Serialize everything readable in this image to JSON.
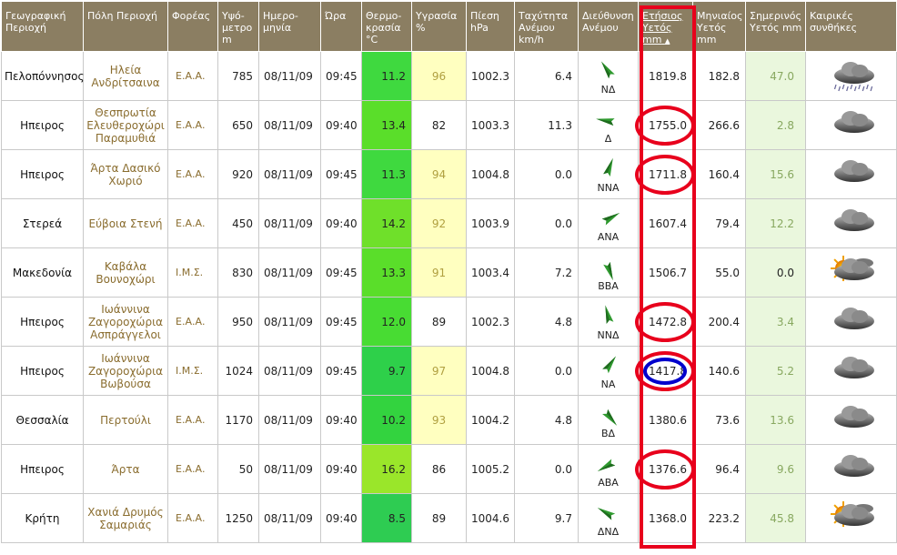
{
  "headers": {
    "region": "Γεωγραφική Περιοχή",
    "city": "Πόλη Περιοχή",
    "operator": "Φορέας",
    "altitude": "Υψό-μετρο m",
    "date": "Ημερο-μηνία",
    "time": "Ώρα",
    "temperature": "Θερμο-κρασία °C",
    "humidity": "Υγρασία %",
    "pressure": "Πίεση hPa",
    "wind_speed": "Ταχύτητα Ανέμου km/h",
    "wind_dir": "Διεύθυνση Ανέμου",
    "annual_rain": "Ετήσιος Υετός mm",
    "monthly_rain": "Μηνιαίος Υετός mm",
    "today_rain": "Σημερινός Υετός mm",
    "conditions": "Καιρικές συνθήκες"
  },
  "sort_indicator": "▲",
  "colors": {
    "header_bg": "#8b7e62",
    "highlight_red": "#e8001c",
    "highlight_blue": "#0000cc",
    "wind_arrow": "#2f9a2f"
  },
  "rows": [
    {
      "region": "Πελοπόννησος",
      "city": "Ηλεία Ανδρίτσαινα",
      "operator": "Ε.Α.Α.",
      "altitude": "785",
      "date": "08/11/09",
      "time": "09:45",
      "temp": "11.2",
      "temp_color": "#3fd93f",
      "humidity": "96",
      "hum_hi": true,
      "pressure": "1002.3",
      "wind_speed": "6.4",
      "wind_dir": "ΝΔ",
      "wind_angle": -35,
      "annual": "1819.8",
      "monthly": "182.8",
      "today": "47.0",
      "weather": "rain-cloud-icon"
    },
    {
      "region": "Ηπειρος",
      "city": "Θεσπρωτία Ελευθεροχώρι Παραμυθιά",
      "operator": "Ε.Α.Α.",
      "altitude": "650",
      "date": "08/11/09",
      "time": "09:40",
      "temp": "13.4",
      "temp_color": "#5ade2a",
      "humidity": "82",
      "hum_hi": false,
      "pressure": "1003.3",
      "wind_speed": "11.3",
      "wind_dir": "Δ",
      "wind_angle": -80,
      "annual": "1755.0",
      "monthly": "266.6",
      "today": "2.8",
      "weather": "cloud-icon"
    },
    {
      "region": "Ηπειρος",
      "city": "Άρτα Δασικό Χωριό",
      "operator": "Ε.Α.Α.",
      "altitude": "920",
      "date": "08/11/09",
      "time": "09:45",
      "temp": "11.3",
      "temp_color": "#3fd93f",
      "humidity": "94",
      "hum_hi": true,
      "pressure": "1004.8",
      "wind_speed": "0.0",
      "wind_dir": "ΝΝΑ",
      "wind_angle": 20,
      "annual": "1711.8",
      "monthly": "160.4",
      "today": "15.6",
      "weather": "cloud-icon"
    },
    {
      "region": "Στερεά",
      "city": "Εύβοια Στενή",
      "operator": "Ε.Α.Α.",
      "altitude": "450",
      "date": "08/11/09",
      "time": "09:40",
      "temp": "14.2",
      "temp_color": "#6fe02a",
      "humidity": "92",
      "hum_hi": true,
      "pressure": "1003.9",
      "wind_speed": "0.0",
      "wind_dir": "ΑΝΑ",
      "wind_angle": 60,
      "annual": "1607.4",
      "monthly": "79.4",
      "today": "12.2",
      "weather": "cloud-icon"
    },
    {
      "region": "Μακεδονία",
      "city": "Καβάλα Βουνοχώρι",
      "operator": "Ι.Μ.Σ.",
      "altitude": "830",
      "date": "08/11/09",
      "time": "09:45",
      "temp": "13.3",
      "temp_color": "#5ade2a",
      "humidity": "91",
      "hum_hi": true,
      "pressure": "1003.4",
      "wind_speed": "7.2",
      "wind_dir": "ΒΒΑ",
      "wind_angle": 160,
      "annual": "1506.7",
      "monthly": "55.0",
      "today": "0.0",
      "weather": "sun-cloud-icon"
    },
    {
      "region": "Ηπειρος",
      "city": "Ιωάννινα Ζαγοροχώρια Ασπράγγελοι",
      "operator": "Ε.Α.Α.",
      "altitude": "950",
      "date": "08/11/09",
      "time": "09:45",
      "temp": "12.0",
      "temp_color": "#48dc33",
      "humidity": "89",
      "hum_hi": false,
      "pressure": "1002.3",
      "wind_speed": "4.8",
      "wind_dir": "ΝΝΔ",
      "wind_angle": -15,
      "annual": "1472.8",
      "monthly": "200.4",
      "today": "3.4",
      "weather": "cloud-icon"
    },
    {
      "region": "Ηπειρος",
      "city": "Ιωάννινα Ζαγοροχώρια Βωβούσα",
      "operator": "Ι.Μ.Σ.",
      "altitude": "1024",
      "date": "08/11/09",
      "time": "09:45",
      "temp": "9.7",
      "temp_color": "#2ed04a",
      "humidity": "97",
      "hum_hi": true,
      "pressure": "1004.8",
      "wind_speed": "0.0",
      "wind_dir": "ΝΑ",
      "wind_angle": 35,
      "annual": "1417.8",
      "monthly": "140.6",
      "today": "5.2",
      "weather": "cloud-icon"
    },
    {
      "region": "Θεσσαλία",
      "city": "Περτούλι",
      "operator": "Ε.Α.Α.",
      "altitude": "1170",
      "date": "08/11/09",
      "time": "09:40",
      "temp": "10.2",
      "temp_color": "#33d33f",
      "humidity": "93",
      "hum_hi": true,
      "pressure": "1004.2",
      "wind_speed": "4.8",
      "wind_dir": "ΒΔ",
      "wind_angle": 140,
      "annual": "1380.6",
      "monthly": "73.6",
      "today": "13.6",
      "weather": "cloud-icon"
    },
    {
      "region": "Ηπειρος",
      "city": "Άρτα",
      "operator": "Ε.Α.Α.",
      "altitude": "50",
      "date": "08/11/09",
      "time": "09:40",
      "temp": "16.2",
      "temp_color": "#9ae62a",
      "humidity": "86",
      "hum_hi": false,
      "pressure": "1005.2",
      "wind_speed": "0.0",
      "wind_dir": "ΑΒΑ",
      "wind_angle": -120,
      "annual": "1376.6",
      "monthly": "96.4",
      "today": "9.6",
      "weather": "cloud-icon"
    },
    {
      "region": "Κρήτη",
      "city": "Χανιά Δρυμός Σαμαριάς",
      "operator": "Ε.Α.Α.",
      "altitude": "1250",
      "date": "08/11/09",
      "time": "09:40",
      "temp": "8.5",
      "temp_color": "#2ecc52",
      "humidity": "89",
      "hum_hi": false,
      "pressure": "1004.6",
      "wind_speed": "9.7",
      "wind_dir": "ΔΝΔ",
      "wind_angle": -60,
      "annual": "1368.0",
      "monthly": "223.2",
      "today": "45.8",
      "weather": "sun-cloud-icon"
    }
  ],
  "circled_red_rows": [
    1,
    2,
    5,
    8
  ],
  "circled_blue_rows": [
    6
  ]
}
